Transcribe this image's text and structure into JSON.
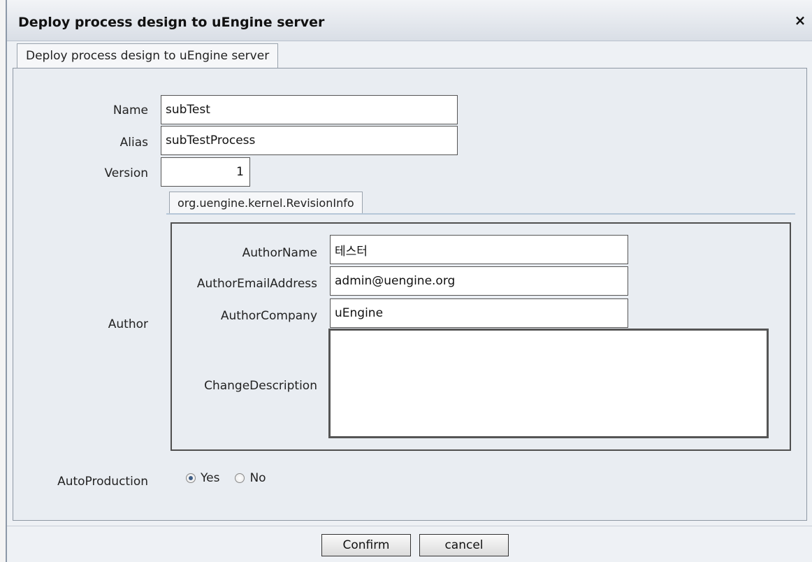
{
  "dialog": {
    "title": "Deploy process design to uEngine server",
    "close_glyph": "×",
    "tab_label": "Deploy process design to uEngine server"
  },
  "form": {
    "name": {
      "label": "Name",
      "value": "subTest"
    },
    "alias": {
      "label": "Alias",
      "value": "subTestProcess"
    },
    "version": {
      "label": "Version",
      "value": "1"
    },
    "author": {
      "label": "Author",
      "tab_label": "org.uengine.kernel.RevisionInfo",
      "author_name": {
        "label": "AuthorName",
        "value": "테스터"
      },
      "author_email": {
        "label": "AuthorEmailAddress",
        "value": "admin@uengine.org"
      },
      "author_company": {
        "label": "AuthorCompany",
        "value": "uEngine"
      },
      "change_description": {
        "label": "ChangeDescription",
        "value": ""
      }
    },
    "auto_production": {
      "label": "AutoProduction",
      "options": [
        {
          "label": "Yes",
          "checked": true
        },
        {
          "label": "No",
          "checked": false
        }
      ]
    }
  },
  "buttons": {
    "confirm": "Confirm",
    "cancel": "cancel"
  }
}
